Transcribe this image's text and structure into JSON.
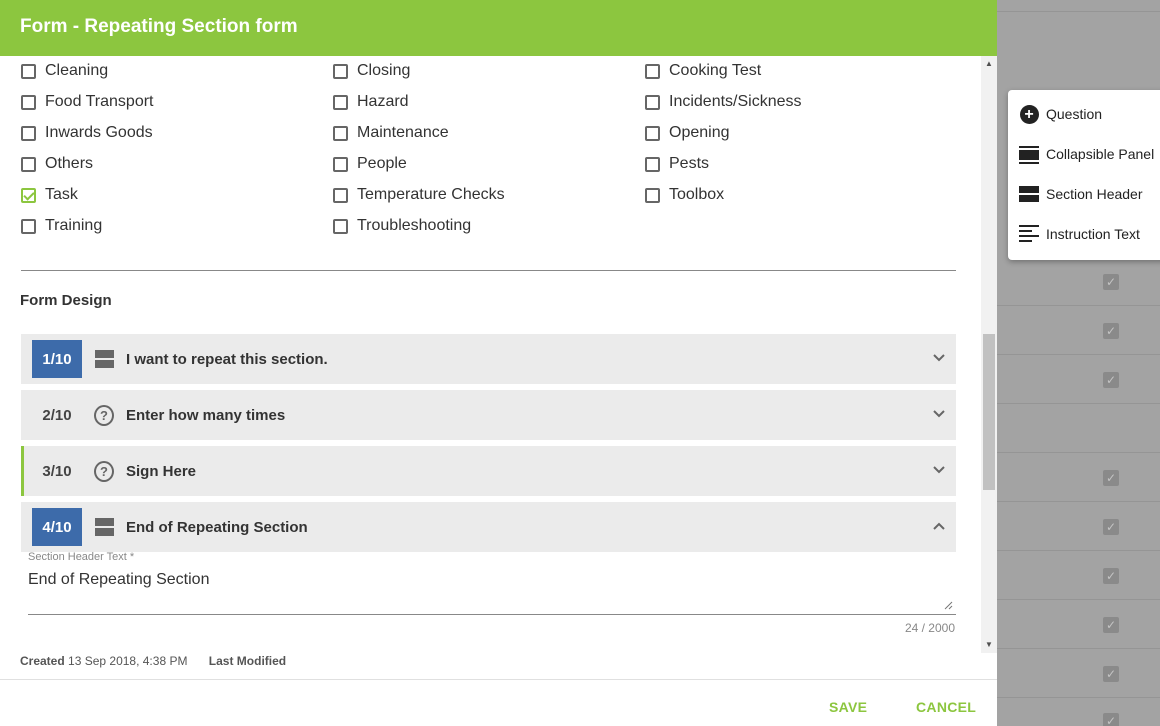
{
  "dialog": {
    "title": "Form - Repeating Section form"
  },
  "categories": {
    "col1": [
      {
        "label": "Cleaning",
        "checked": false
      },
      {
        "label": "Food Transport",
        "checked": false
      },
      {
        "label": "Inwards Goods",
        "checked": false
      },
      {
        "label": "Others",
        "checked": false
      },
      {
        "label": "Task",
        "checked": true
      },
      {
        "label": "Training",
        "checked": false
      }
    ],
    "col2": [
      {
        "label": "Closing",
        "checked": false
      },
      {
        "label": "Hazard",
        "checked": false
      },
      {
        "label": "Maintenance",
        "checked": false
      },
      {
        "label": "People",
        "checked": false
      },
      {
        "label": "Temperature Checks",
        "checked": false
      },
      {
        "label": "Troubleshooting",
        "checked": false
      }
    ],
    "col3": [
      {
        "label": "Cooking Test",
        "checked": false
      },
      {
        "label": "Incidents/Sickness",
        "checked": false
      },
      {
        "label": "Opening",
        "checked": false
      },
      {
        "label": "Pests",
        "checked": false
      },
      {
        "label": "Toolbox",
        "checked": false
      }
    ]
  },
  "form_design": {
    "title": "Form Design",
    "items": [
      {
        "index": "1/10",
        "label": "I want to repeat this section.",
        "icon": "section-header-icon",
        "expanded": false
      },
      {
        "index": "2/10",
        "label": "Enter how many times",
        "icon": "question-icon",
        "expanded": false
      },
      {
        "index": "3/10",
        "label": "Sign Here",
        "icon": "question-icon",
        "expanded": false
      },
      {
        "index": "4/10",
        "label": "End of Repeating Section",
        "icon": "section-header-icon",
        "expanded": true
      }
    ],
    "section_header_field": {
      "label": "Section Header Text *",
      "value": "End of Repeating Section",
      "counter": "24 / 2000"
    }
  },
  "meta": {
    "created_label": "Created",
    "created_value": "13 Sep 2018, 4:38 PM",
    "modified_label": "Last Modified"
  },
  "footer": {
    "save_label": "SAVE",
    "cancel_label": "CANCEL"
  },
  "add_menu": {
    "items": [
      {
        "label": "Question",
        "icon": "add-circle-icon"
      },
      {
        "label": "Collapsible Panel",
        "icon": "collapsible-panel-icon"
      },
      {
        "label": "Section Header",
        "icon": "section-header-icon"
      },
      {
        "label": "Instruction Text",
        "icon": "instruction-text-icon"
      }
    ]
  },
  "colors": {
    "accent": "#8cc63f",
    "badge_blue": "#3d6baa",
    "overlay": "#a3a3a3"
  }
}
